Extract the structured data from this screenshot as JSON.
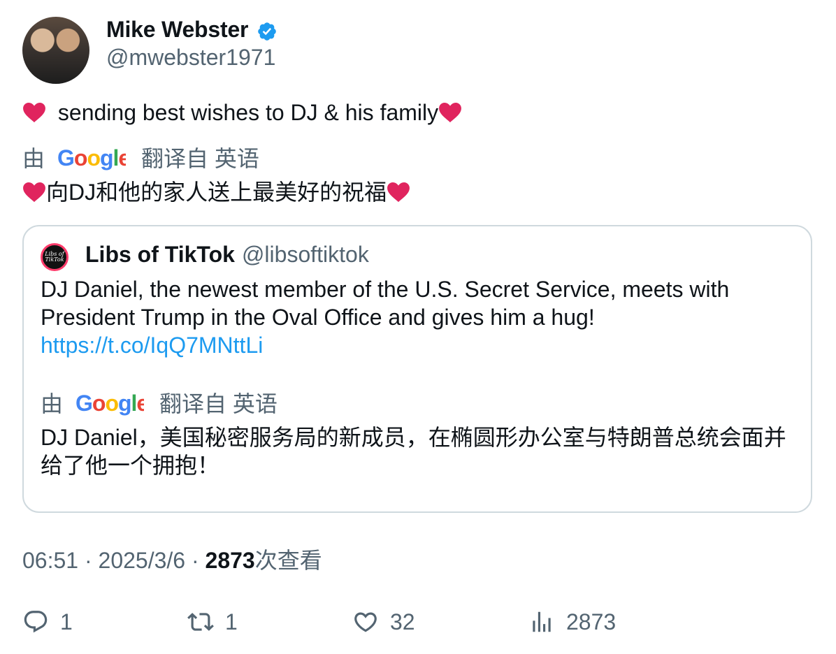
{
  "author": {
    "display_name": "Mike Webster",
    "handle": "@mwebster1971",
    "verified": true,
    "verified_color": "#1d9bf0"
  },
  "tweet": {
    "text": "sending best wishes to DJ & his family",
    "translate": {
      "by": "由",
      "from": "翻译自 英语"
    },
    "translated_text": "向DJ和他的家人送上最美好的祝福"
  },
  "quote": {
    "avatar_text": "Libs of TikTok",
    "display_name": "Libs of TikTok",
    "handle": "@libsoftiktok",
    "text": "DJ Daniel, the newest member of the U.S. Secret Service, meets with President Trump in the Oval Office and gives him a hug!",
    "link": "https://t.co/IqQ7MNttLi",
    "translate": {
      "by": "由",
      "from": "翻译自 英语"
    },
    "translated_text": "DJ Daniel，美国秘密服务局的新成员，在椭圆形办公室与特朗普总统会面并给了他一个拥抱！"
  },
  "meta": {
    "time": "06:51",
    "separator": " · ",
    "date": "2025/3/6",
    "views_count": "2873",
    "views_label": "次查看"
  },
  "actions": {
    "replies": "1",
    "reposts": "1",
    "likes": "32",
    "views": "2873"
  },
  "colors": {
    "text": "#0f1419",
    "secondary": "#536471",
    "link": "#1d9bf0",
    "border": "#cfd9de",
    "heart": "#e0245e"
  }
}
